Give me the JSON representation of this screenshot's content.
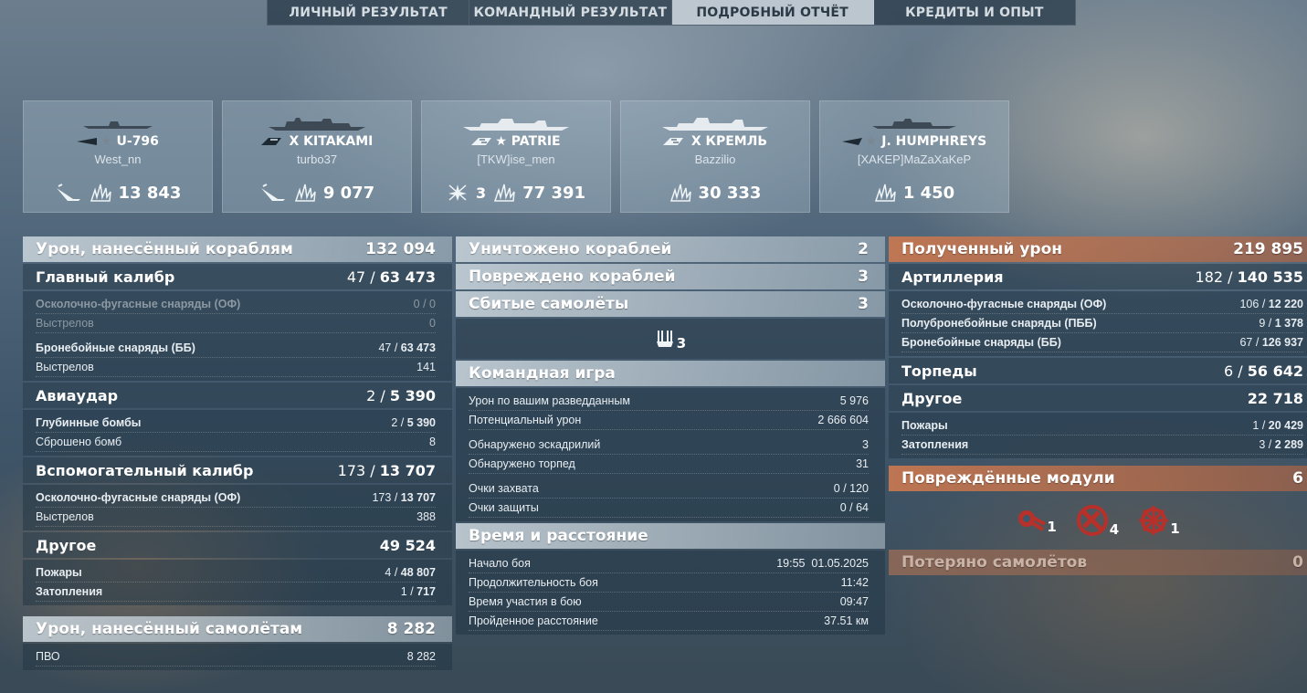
{
  "tabs": [
    {
      "label": "ЛИЧНЫЙ РЕЗУЛЬТАТ"
    },
    {
      "label": "КОМАНДНЫЙ РЕЗУЛЬТАТ"
    },
    {
      "label": "ПОДРОБНЫЙ ОТЧЁТ"
    },
    {
      "label": "КРЕДИТЫ И ОПЫТ"
    }
  ],
  "active_tab": "ПОДРОБНЫЙ ОТЧЁТ",
  "ships": [
    {
      "name": "U-796",
      "player": "West_nn",
      "class_icon": "submarine-icon",
      "torpedo_icon": "torpedo-hit-icon",
      "damage": "13 843"
    },
    {
      "name": "X KITAKAMI",
      "player": "turbo37",
      "class_icon": "cruiser-icon",
      "torpedo_icon": "torpedo-hit-icon",
      "damage": "9 077"
    },
    {
      "name": "PATRIE",
      "player": "[TKW]ise_men",
      "class_icon": "battleship-icon",
      "planes_destroyed": "3",
      "damage": "77 391"
    },
    {
      "name": "X КРЕМЛЬ",
      "player": "Bazzilio",
      "class_icon": "battleship-icon",
      "damage": "30 333"
    },
    {
      "name": "J. HUMPHREYS",
      "player": "[XAKEP]MaZaXaKeP",
      "class_icon": "destroyer-icon",
      "damage": "1 450"
    }
  ],
  "left": {
    "ship_damage": {
      "label": "Урон, нанесённый кораблям",
      "value": "132 094"
    },
    "main_battery": {
      "label": "Главный калибр",
      "hits": "47",
      "total": "63 473"
    },
    "he_shells": {
      "label": "Осколочно-фугасные снаряды (ОФ)",
      "value": "0 / 0"
    },
    "he_shots": {
      "label": "Выстрелов",
      "value": "0"
    },
    "ap_shells": {
      "label": "Бронебойные снаряды (ББ)",
      "hits": "47",
      "total": "63 473"
    },
    "ap_shots": {
      "label": "Выстрелов",
      "value": "141"
    },
    "airstrike": {
      "label": "Авиаудар",
      "hits": "2",
      "total": "5 390"
    },
    "depth_charges": {
      "label": "Глубинные бомбы",
      "hits": "2",
      "total": "5 390"
    },
    "bombs_dropped": {
      "label": "Сброшено бомб",
      "value": "8"
    },
    "secondary": {
      "label": "Вспомогательный калибр",
      "hits": "173",
      "total": "13 707"
    },
    "sec_he": {
      "label": "Осколочно-фугасные снаряды (ОФ)",
      "hits": "173",
      "total": "13 707"
    },
    "sec_shots": {
      "label": "Выстрелов",
      "value": "388"
    },
    "other": {
      "label": "Другое",
      "value": "49 524"
    },
    "fires": {
      "label": "Пожары",
      "hits": "4",
      "total": "48 807"
    },
    "floods": {
      "label": "Затопления",
      "hits": "1",
      "total": "717"
    },
    "plane_damage": {
      "label": "Урон, нанесённый самолётам",
      "value": "8 282"
    },
    "aa": {
      "label": "ПВО",
      "value": "8 282"
    }
  },
  "middle": {
    "destroyed": {
      "label": "Уничтожено кораблей",
      "value": "2"
    },
    "damaged": {
      "label": "Повреждено кораблей",
      "value": "3"
    },
    "planes_shot": {
      "label": "Сбитые самолёты",
      "value": "3"
    },
    "aa_icon_count": "3",
    "teamplay": {
      "label": "Командная игра"
    },
    "spotting_damage": {
      "label": "Урон по вашим разведданным",
      "value": "5 976"
    },
    "potential_damage": {
      "label": "Потенциальный урон",
      "value": "2 666 604"
    },
    "squadrons_spotted": {
      "label": "Обнаружено эскадрилий",
      "value": "3"
    },
    "torpedoes_spotted": {
      "label": "Обнаружено торпед",
      "value": "31"
    },
    "capture_points": {
      "label": "Очки захвата",
      "value": "0 / 120"
    },
    "defense_points": {
      "label": "Очки защиты",
      "value": "0 / 64"
    },
    "time_distance": {
      "label": "Время и расстояние"
    },
    "battle_start": {
      "label": "Начало боя",
      "value": "19:55  01.05.2025"
    },
    "battle_duration": {
      "label": "Продолжительность боя",
      "value": "11:42"
    },
    "participation": {
      "label": "Время участия в бою",
      "value": "09:47"
    },
    "distance": {
      "label": "Пройденное расстояние",
      "value": "37.51 км"
    }
  },
  "right": {
    "received": {
      "label": "Полученный урон",
      "value": "219 895"
    },
    "artillery": {
      "label": "Артиллерия",
      "hits": "182",
      "total": "140 535"
    },
    "he": {
      "label": "Осколочно-фугасные снаряды (ОФ)",
      "hits": "106",
      "total": "12 220"
    },
    "sap": {
      "label": "Полубронебойные снаряды (ПББ)",
      "hits": "9",
      "total": "1 378"
    },
    "ap": {
      "label": "Бронебойные снаряды (ББ)",
      "hits": "67",
      "total": "126 937"
    },
    "torpedoes": {
      "label": "Торпеды",
      "hits": "6",
      "total": "56 642"
    },
    "other": {
      "label": "Другое",
      "value": "22 718"
    },
    "fires": {
      "label": "Пожары",
      "hits": "1",
      "total": "20 429"
    },
    "floods": {
      "label": "Затопления",
      "hits": "3",
      "total": "2 289"
    },
    "modules": {
      "label": "Повреждённые модули",
      "value": "6"
    },
    "module_items": [
      {
        "icon": "gun-turret-icon",
        "count": "1"
      },
      {
        "icon": "torpedo-tube-icon",
        "count": "4"
      },
      {
        "icon": "steering-gear-icon",
        "count": "1"
      }
    ],
    "planes_lost": {
      "label": "Потеряно самолётов",
      "value": "0"
    }
  },
  "colors": {
    "accent_orange": "#c8784f",
    "header_light": "#cdd7de"
  }
}
